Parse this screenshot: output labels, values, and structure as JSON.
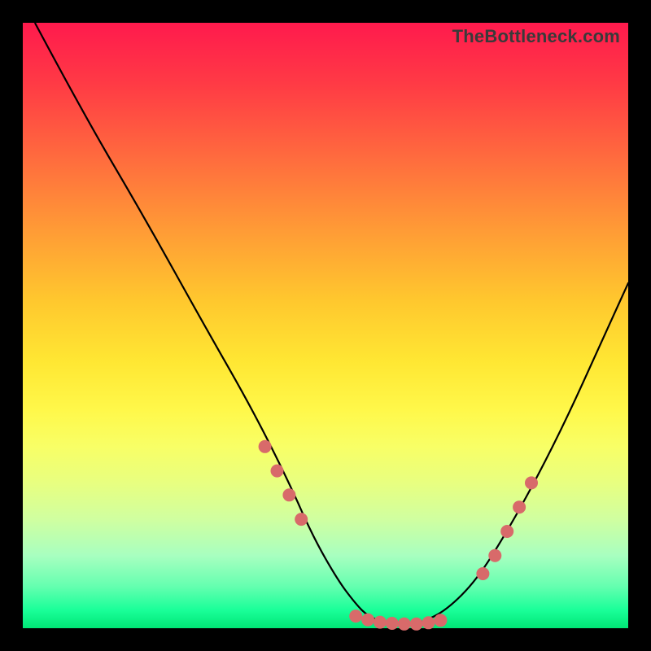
{
  "watermark": "TheBottleneck.com",
  "colors": {
    "page_bg": "#000000",
    "marker": "#d86a6a",
    "curve": "#000000",
    "gradient_top": "#ff1a4d",
    "gradient_bottom": "#00e676"
  },
  "chart_data": {
    "type": "line",
    "title": "",
    "xlabel": "",
    "ylabel": "",
    "xlim": [
      0,
      100
    ],
    "ylim": [
      0,
      100
    ],
    "grid": false,
    "legend": false,
    "note": "Axes have no visible tick labels; x/y in percent of plot width/height with (0,0) at bottom-left. Values estimated from pixel positions.",
    "series": [
      {
        "name": "curve",
        "x": [
          2,
          10,
          20,
          30,
          38,
          44,
          48,
          52,
          55,
          57,
          60,
          62,
          64,
          66,
          70,
          75,
          80,
          85,
          90,
          95,
          100
        ],
        "y": [
          100,
          85,
          68,
          50,
          36,
          24,
          15,
          8,
          4,
          2,
          0.8,
          0.5,
          0.5,
          1,
          3,
          8,
          16,
          25,
          35,
          46,
          57
        ]
      }
    ],
    "markers": {
      "name": "highlighted-points",
      "x": [
        40,
        42,
        44,
        46,
        55,
        57,
        59,
        61,
        63,
        65,
        67,
        69,
        76,
        78,
        80,
        82,
        84
      ],
      "y": [
        30,
        26,
        22,
        18,
        2,
        1.4,
        1.0,
        0.8,
        0.7,
        0.7,
        0.9,
        1.3,
        9,
        12,
        16,
        20,
        24
      ],
      "color": "#d86a6a",
      "radius_px": 8
    }
  }
}
